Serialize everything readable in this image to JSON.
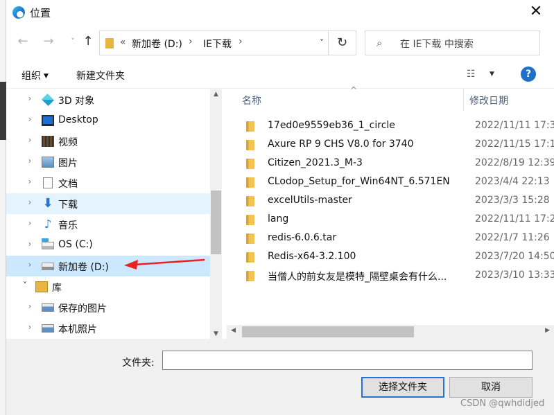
{
  "window": {
    "title": "位置",
    "close": "✕"
  },
  "nav": {
    "back": "←",
    "forward": "→",
    "recent": "˅",
    "up": "↑"
  },
  "address": {
    "overflow": "«",
    "segments": [
      "新加卷 (D:)",
      "IE下载"
    ],
    "separator": "›",
    "dropdown": "˅",
    "refresh": "↻"
  },
  "search": {
    "placeholder": "在 IE下载 中搜索",
    "icon": "⌕"
  },
  "toolbar": {
    "organize": "组织",
    "organize_caret": "▼",
    "new_folder": "新建文件夹",
    "view_icon": "☷",
    "view_caret": "▼",
    "help": "?"
  },
  "navpane": {
    "items": [
      {
        "label": "3D 对象",
        "icon": "3d-objects-icon"
      },
      {
        "label": "Desktop",
        "icon": "desktop-icon"
      },
      {
        "label": "视频",
        "icon": "video-icon"
      },
      {
        "label": "图片",
        "icon": "pictures-icon"
      },
      {
        "label": "文档",
        "icon": "documents-icon"
      },
      {
        "label": "下载",
        "icon": "downloads-icon"
      },
      {
        "label": "音乐",
        "icon": "music-icon"
      },
      {
        "label": "OS (C:)",
        "icon": "drive-c-icon"
      },
      {
        "label": "新加卷 (D:)",
        "icon": "drive-d-icon"
      },
      {
        "label": "库",
        "icon": "library-icon"
      },
      {
        "label": "保存的图片",
        "icon": "saved-pictures-icon"
      },
      {
        "label": "本机照片",
        "icon": "camera-roll-icon"
      }
    ],
    "chevron": "›",
    "chevron_open": "˅"
  },
  "filelist": {
    "headers": {
      "name": "名称",
      "date": "修改日期",
      "sort_arrow": "^"
    },
    "rows": [
      {
        "name": "17ed0e9559eb36_1_circle",
        "date": "2022/11/11 17:3"
      },
      {
        "name": "Axure RP 9 CHS V8.0 for 3740",
        "date": "2022/11/15 17:1"
      },
      {
        "name": "Citizen_2021.3_M-3",
        "date": "2022/8/19 12:39"
      },
      {
        "name": "CLodop_Setup_for_Win64NT_6.571EN",
        "date": "2023/4/4 22:13"
      },
      {
        "name": "excelUtils-master",
        "date": "2023/3/3 15:28"
      },
      {
        "name": "lang",
        "date": "2022/11/11 17:2"
      },
      {
        "name": "redis-6.0.6.tar",
        "date": "2022/1/7 11:26"
      },
      {
        "name": "Redis-x64-3.2.100",
        "date": "2023/7/20 14:50"
      },
      {
        "name": "当僧人的前女友是模特_隔壁桌会有什么...",
        "date": "2023/3/10 13:33"
      }
    ]
  },
  "scroll": {
    "up": "▲",
    "down": "▼",
    "left": "◀",
    "right": "▶"
  },
  "bottom": {
    "folder_label": "文件夹:",
    "folder_value": "",
    "select_button": "选择文件夹",
    "cancel_button": "取消"
  },
  "watermark": "CSDN @qwhdidjed",
  "colors": {
    "selection": "#cce8ff",
    "hover": "#e5f3ff",
    "accent": "#2472d6",
    "annotation_arrow": "#e8231f"
  }
}
